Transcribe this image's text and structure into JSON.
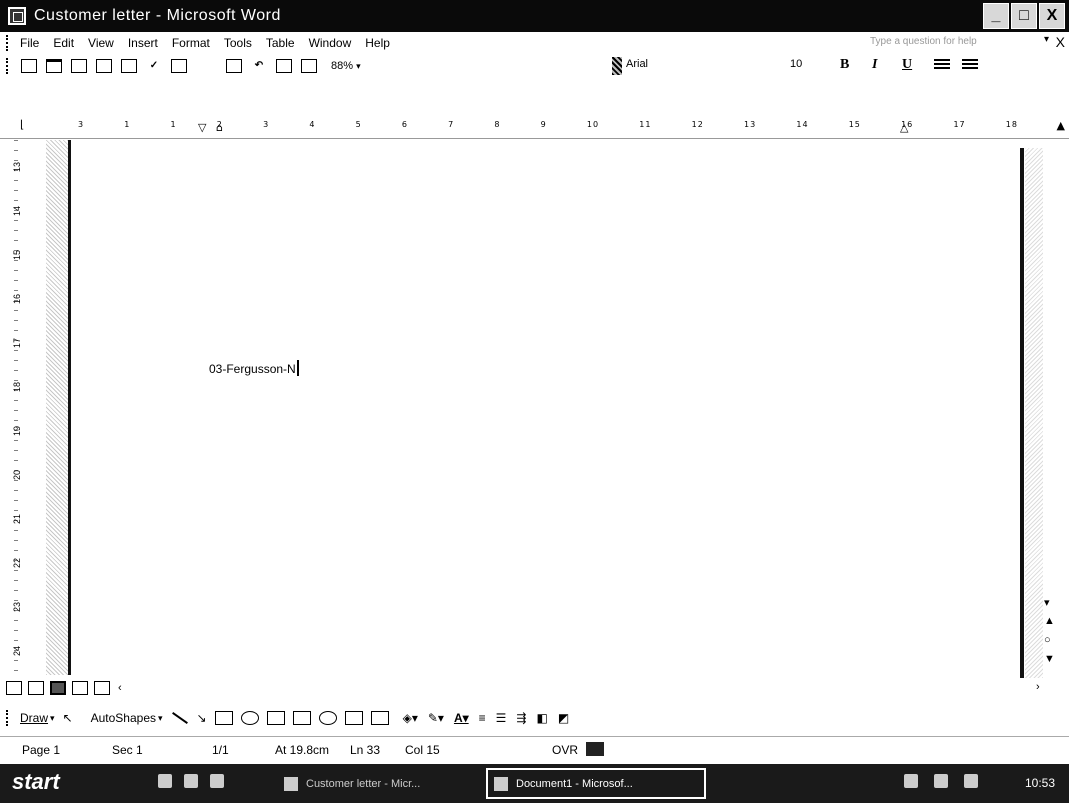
{
  "window": {
    "title": "Customer letter - Microsoft Word",
    "buttons": {
      "minimize": "_",
      "maximize": "□",
      "close": "X"
    }
  },
  "menu": {
    "items": [
      "File",
      "Edit",
      "View",
      "Insert",
      "Format",
      "Tools",
      "Table",
      "Window",
      "Help"
    ],
    "help_placeholder": "Type a question for help",
    "close": "X"
  },
  "toolbar": {
    "zoom": "88%",
    "font": "Arial",
    "size": "10",
    "bold": "B",
    "italic": "I",
    "underline": "U"
  },
  "ruler": {
    "ticks": [
      "3",
      "1",
      "1",
      "2",
      "3",
      "4",
      "5",
      "6",
      "7",
      "8",
      "9",
      "10",
      "11",
      "12",
      "13",
      "14",
      "15",
      "16",
      "17",
      "18"
    ]
  },
  "vruler": {
    "ticks": [
      "13",
      "14",
      "15",
      "16",
      "17",
      "18",
      "19",
      "20",
      "21",
      "22",
      "23",
      "24"
    ]
  },
  "document": {
    "text": "03-Fergusson-N"
  },
  "drawbar": {
    "draw": "Draw",
    "autoshapes": "AutoShapes"
  },
  "status": {
    "page": "Page 1",
    "sec": "Sec 1",
    "pages": "1/1",
    "at": "At 19.8cm",
    "ln": "Ln 33",
    "col": "Col 15",
    "ovr": "OVR"
  },
  "taskbar": {
    "start": "start",
    "tasks": [
      "Customer letter - Micr...",
      "Document1 - Microsof..."
    ],
    "clock": "10:53"
  }
}
